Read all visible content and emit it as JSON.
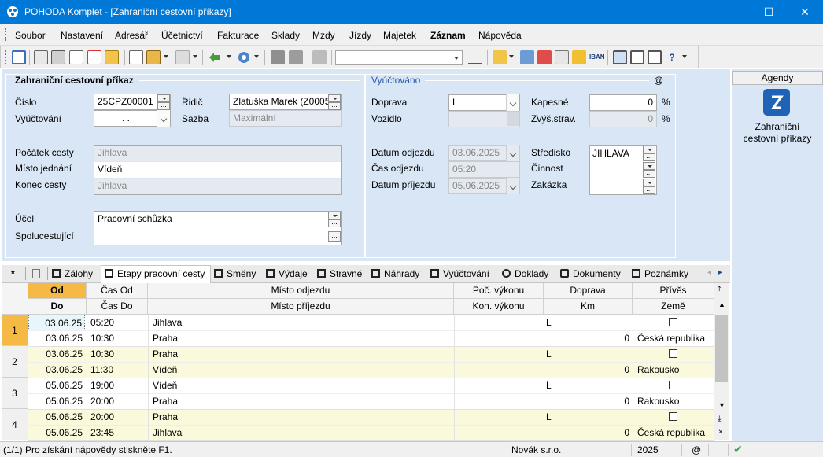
{
  "window": {
    "title": "POHODA Komplet - [Zahraniční cestovní příkazy]",
    "minimize": "—",
    "maximize": "☐",
    "close": "✕"
  },
  "menu": [
    "Soubor",
    "Nastavení",
    "Adresář",
    "Účetnictví",
    "Fakturace",
    "Sklady",
    "Mzdy",
    "Jízdy",
    "Majetek",
    "Záznam",
    "Nápověda"
  ],
  "form": {
    "section_title": "Zahraniční cestovní příkaz",
    "cislo_label": "Číslo",
    "cislo_value": "25CPZ00001",
    "vyuctovani_label": "Vyúčtování",
    "vyuctovani_value": ". .",
    "ridic_label": "Řidič",
    "ridic_value": "Zlatuška Marek (Z0005",
    "sazba_label": "Sazba",
    "sazba_value": "Maximální",
    "pocatek_label": "Počátek cesty",
    "pocatek_value": "Jihlava",
    "misto_label": "Místo jednání",
    "misto_value": "Vídeň",
    "konec_label": "Konec cesty",
    "konec_value": "Jihlava",
    "ucel_label": "Účel",
    "ucel_value": "Pracovní schůzka",
    "spolucestujici_label": "Spolucestující",
    "vyuctovano_title": "Vyúčtováno",
    "at_sign": "@",
    "doprava_label": "Doprava",
    "doprava_value": "L",
    "vozidlo_label": "Vozidlo",
    "kapesne_label": "Kapesné",
    "kapesne_value": "0",
    "kapesne_unit": "%",
    "zvys_label": "Zvýš.strav.",
    "zvys_value": "0",
    "zvys_unit": "%",
    "datum_odj_label": "Datum odjezdu",
    "datum_odj_value": "03.06.2025",
    "cas_odj_label": "Čas odjezdu",
    "cas_odj_value": "05:20",
    "datum_prij_label": "Datum příjezdu",
    "datum_prij_value": "05.06.2025",
    "stredisko_label": "Středisko",
    "stredisko_value": "JIHLAVA",
    "cinnost_label": "Činnost",
    "zakazka_label": "Zakázka"
  },
  "agendy": {
    "title": "Agendy",
    "item_label": "Zahraniční cestovní příkazy"
  },
  "tabs": [
    "Zálohy",
    "Etapy pracovní cesty",
    "Směny",
    "Výdaje",
    "Stravné",
    "Náhrady",
    "Vyúčtování",
    "Doklady",
    "Dokumenty",
    "Poznámky"
  ],
  "tab_star": "*",
  "grid": {
    "headers_top": [
      "Od",
      "Čas Od",
      "Místo odjezdu",
      "Poč. výkonu",
      "Doprava",
      "Přívěs"
    ],
    "headers_bottom": [
      "Do",
      "Čas Do",
      "Místo příjezdu",
      "Kon. výkonu",
      "Km",
      "Země"
    ],
    "rows": [
      {
        "num": "1",
        "od": "03.06.25",
        "cas_od": "05:20",
        "misto_odj": "Jihlava",
        "doprava": "L",
        "do": "03.06.25",
        "cas_do": "10:30",
        "misto_prij": "Praha",
        "km": "0",
        "zeme": "Česká republika"
      },
      {
        "num": "2",
        "od": "03.06.25",
        "cas_od": "10:30",
        "misto_odj": "Praha",
        "doprava": "L",
        "do": "03.06.25",
        "cas_do": "11:30",
        "misto_prij": "Vídeň",
        "km": "0",
        "zeme": "Rakousko"
      },
      {
        "num": "3",
        "od": "05.06.25",
        "cas_od": "19:00",
        "misto_odj": "Vídeň",
        "doprava": "L",
        "do": "05.06.25",
        "cas_do": "20:00",
        "misto_prij": "Praha",
        "km": "0",
        "zeme": "Rakousko"
      },
      {
        "num": "4",
        "od": "05.06.25",
        "cas_od": "20:00",
        "misto_odj": "Praha",
        "doprava": "L",
        "do": "05.06.25",
        "cas_do": "23:45",
        "misto_prij": "Jihlava",
        "km": "0",
        "zeme": "Česká republika"
      }
    ]
  },
  "status": {
    "help": "(1/1) Pro získání nápovědy stiskněte F1.",
    "company": "Novák s.r.o.",
    "year": "2025",
    "at": "@"
  },
  "colors": {
    "titlebar": "#0078d7",
    "panel": "#d9e6f5",
    "row_yellow": "#fbf9db",
    "row_selected": "#f5b945"
  }
}
